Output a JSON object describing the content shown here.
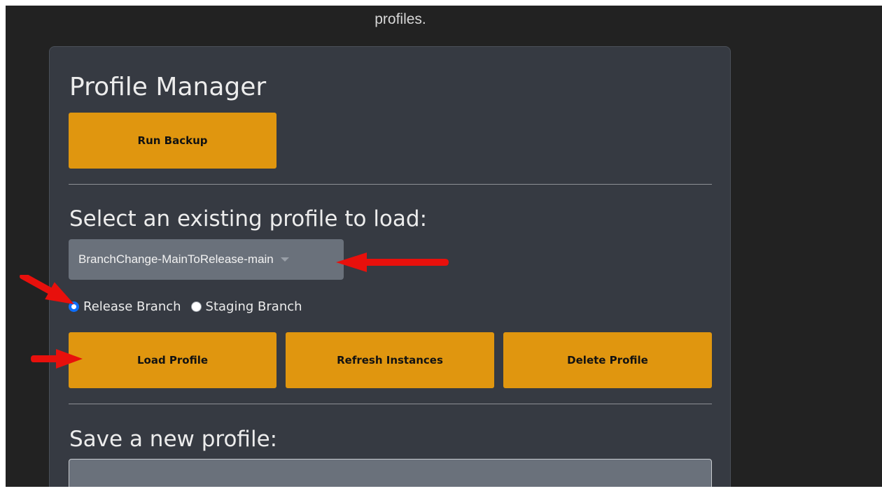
{
  "header": {
    "text": "profiles."
  },
  "panel": {
    "title": "Profile Manager",
    "backup_label": "Run Backup",
    "select_heading": "Select an existing profile to load:",
    "profile_select": {
      "selected": "BranchChange-MainToRelease-main"
    },
    "branch_options": [
      {
        "label": "Release Branch",
        "checked": true
      },
      {
        "label": "Staging Branch",
        "checked": false
      }
    ],
    "buttons": {
      "load": "Load Profile",
      "refresh": "Refresh Instances",
      "delete": "Delete Profile"
    },
    "save_heading": "Save a new profile:",
    "new_profile_input": {
      "value": ""
    }
  },
  "colors": {
    "accent": "#e0960f",
    "panel_bg": "#363a42",
    "page_bg": "#222222",
    "annotation_arrow": "#e8100c",
    "radio_selected": "#0d6efd"
  }
}
